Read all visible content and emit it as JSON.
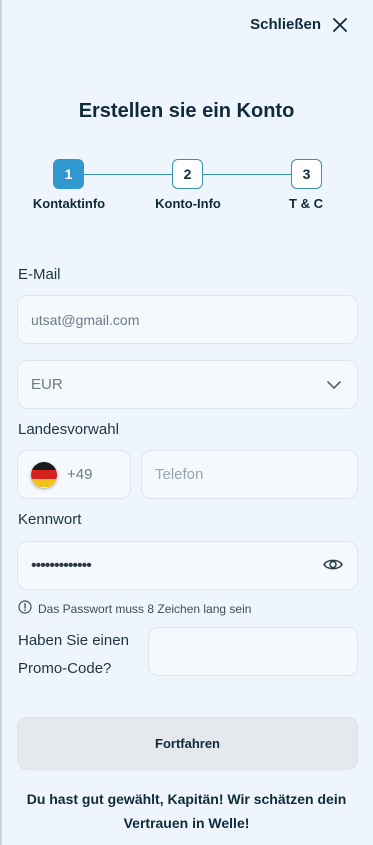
{
  "header": {
    "close_label": "Schließen"
  },
  "title": "Erstellen sie ein Konto",
  "steps": [
    {
      "number": "1",
      "label": "Kontaktinfo",
      "active": true
    },
    {
      "number": "2",
      "label": "Konto-Info",
      "active": false
    },
    {
      "number": "3",
      "label": "T & C",
      "active": false
    }
  ],
  "form": {
    "email_label": "E-Mail",
    "email_value": "utsat@gmail.com",
    "currency_value": "EUR",
    "phone_label": "Landesvorwahl",
    "phone_code": "+49",
    "phone_placeholder": "Telefon",
    "password_label": "Kennwort",
    "password_masked": "•••••••••••••",
    "password_hint": "Das Passwort muss 8 Zeichen lang sein",
    "promo_label": "Haben Sie einen Promo-Code?",
    "promo_value": ""
  },
  "submit_label": "Fortfahren",
  "footer_text": "Du hast gut gewählt, Kapitän! Wir schätzen dein Vertrauen in Welle!",
  "colors": {
    "background": "#eef5fc",
    "accent": "#3197cf",
    "text": "#0f2a3a",
    "button": "#e5e9ee"
  }
}
